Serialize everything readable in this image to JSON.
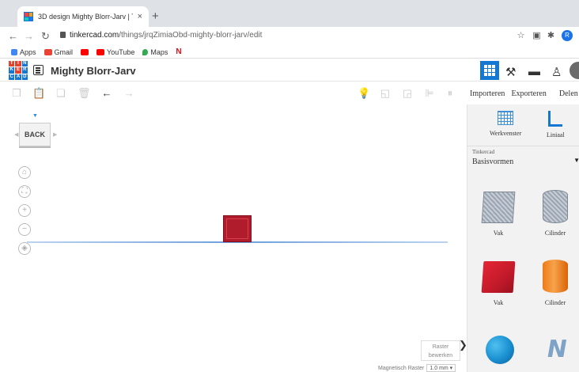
{
  "browser": {
    "tab_title": "3D design Mighty Blorr-Jarv | T",
    "tab_close": "×",
    "new_tab": "+",
    "url_host": "tinkercad.com",
    "url_path": "/things/jrqZimiaObd-mighty-blorr-jarv/edit",
    "profile_initial": "R",
    "bookmarks": [
      {
        "label": "Apps",
        "icon": "apps-grid-icon",
        "color": "#4285f4"
      },
      {
        "label": "Gmail",
        "icon": "gmail-icon",
        "color": "#ea4335"
      },
      {
        "label": "",
        "icon": "youtube-icon",
        "color": "#ff0000"
      },
      {
        "label": "YouTube",
        "icon": "youtube-icon",
        "color": "#ff0000"
      },
      {
        "label": "Maps",
        "icon": "maps-pin-icon",
        "color": "#34a853"
      },
      {
        "label": "",
        "icon": "netflix-icon",
        "color": "#e50914"
      }
    ]
  },
  "tinkercad": {
    "logo_letters": [
      "T",
      "I",
      "N",
      "K",
      "E",
      "R",
      "C",
      "A",
      "D"
    ],
    "project_title": "Mighty Blorr-Jarv",
    "accent_color": "#1477d1",
    "view_cube_label": "BACK",
    "panel_buttons": {
      "import": "Importeren",
      "export": "Exporteren",
      "share": "Delen"
    },
    "workplane_label": "Werkvenster",
    "ruler_label": "Liniaal",
    "category_source": "Tinkercad",
    "category_name": "Basisvormen",
    "raster_button": [
      "Raster",
      "bewerken"
    ],
    "snap_grid_label": "Magnetisch Raster",
    "snap_grid_value": "1.0 mm",
    "shapes": [
      {
        "label": "Vak",
        "kind": "box-hole"
      },
      {
        "label": "Cilinder",
        "kind": "cylinder-hole"
      },
      {
        "label": "Vak",
        "kind": "box"
      },
      {
        "label": "Cilinder",
        "kind": "cylinder"
      },
      {
        "label": "",
        "kind": "sphere"
      },
      {
        "label": "",
        "kind": "text"
      }
    ]
  }
}
